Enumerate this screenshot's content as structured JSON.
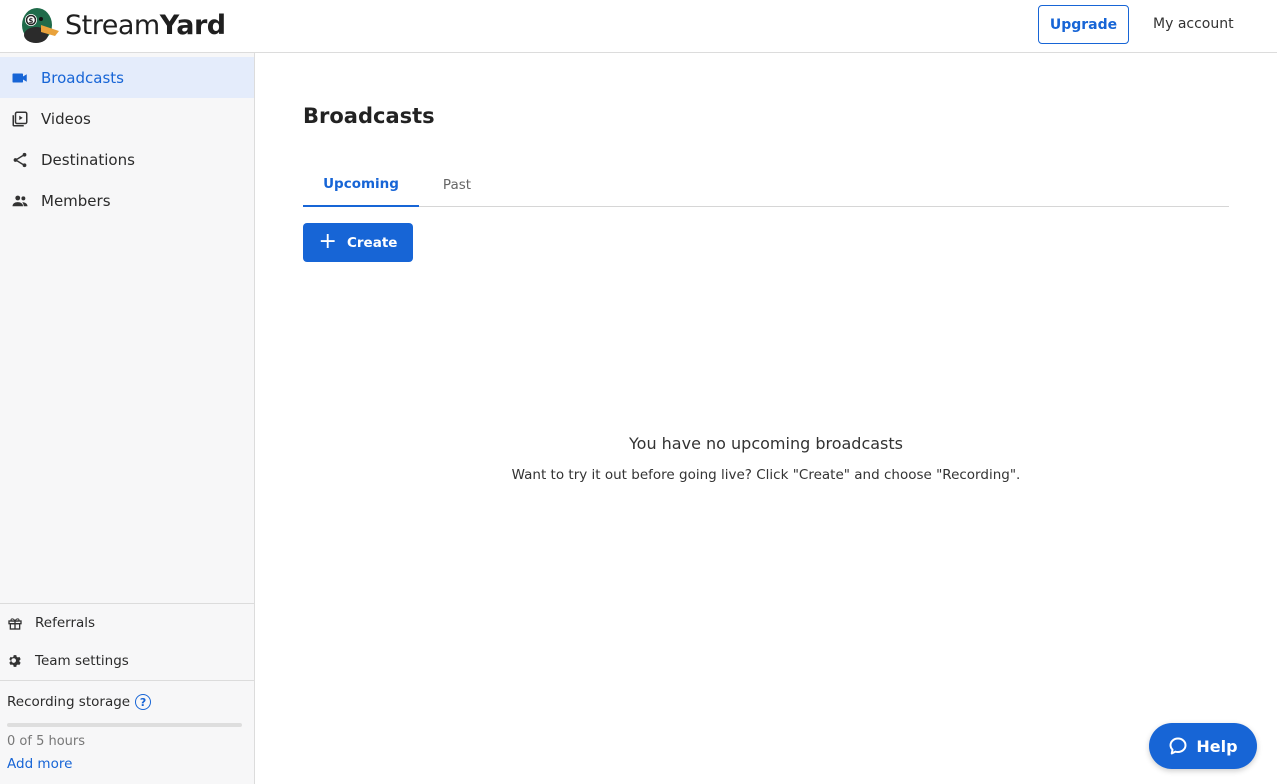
{
  "app": {
    "name_regular": "Stream",
    "name_bold": "Yard"
  },
  "header": {
    "upgrade_label": "Upgrade",
    "account_label": "My account"
  },
  "sidebar": {
    "items": [
      {
        "label": "Broadcasts",
        "icon": "video-camera-icon",
        "active": true
      },
      {
        "label": "Videos",
        "icon": "video-library-icon",
        "active": false
      },
      {
        "label": "Destinations",
        "icon": "share-icon",
        "active": false
      },
      {
        "label": "Members",
        "icon": "people-icon",
        "active": false
      }
    ],
    "secondary": [
      {
        "label": "Referrals",
        "icon": "gift-icon"
      },
      {
        "label": "Team settings",
        "icon": "gear-icon"
      }
    ],
    "storage": {
      "label": "Recording storage",
      "help_glyph": "?",
      "used_fraction": 0,
      "count_text": "0 of 5 hours",
      "add_more_label": "Add more"
    }
  },
  "main": {
    "title": "Broadcasts",
    "tabs": [
      {
        "label": "Upcoming",
        "active": true
      },
      {
        "label": "Past",
        "active": false
      }
    ],
    "create_label": "Create",
    "empty_title": "You have no upcoming broadcasts",
    "empty_subtitle": "Want to try it out before going live? Click \"Create\" and choose \"Recording\"."
  },
  "help": {
    "label": "Help"
  },
  "colors": {
    "accent": "#1765d6",
    "active_bg": "#e4ecfb",
    "sidebar_bg": "#f7f7f8"
  }
}
